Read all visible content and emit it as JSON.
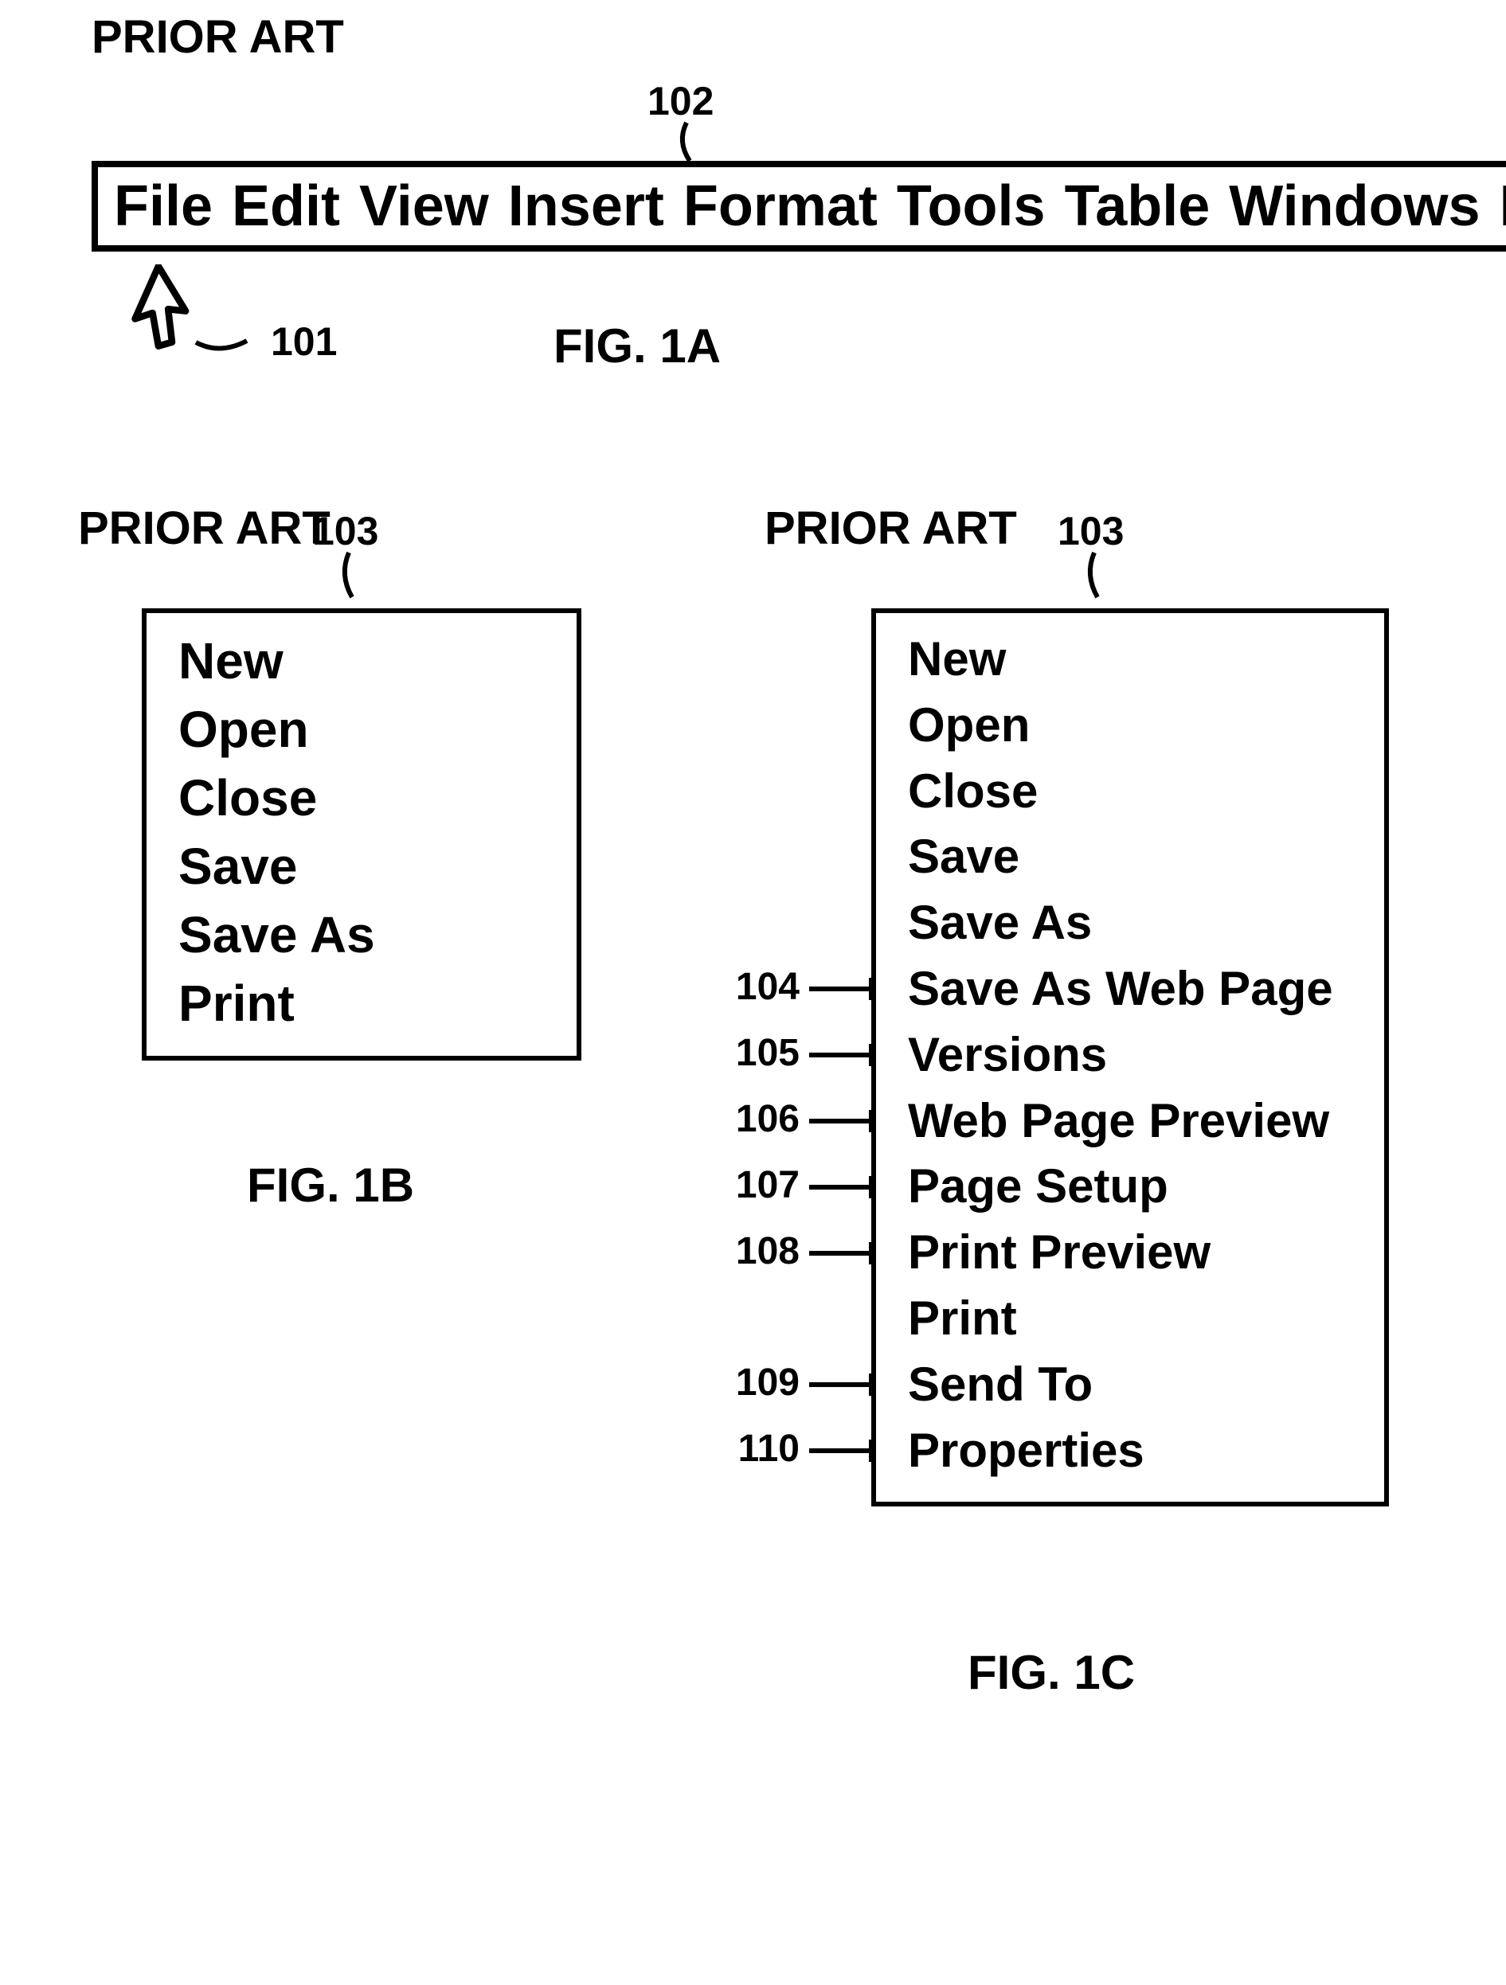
{
  "figA": {
    "prior_art": "PRIOR ART",
    "ref_102": "102",
    "ref_101": "101",
    "caption": "FIG. 1A"
  },
  "menubar": {
    "items": [
      "File",
      "Edit",
      "View",
      "Insert",
      "Format",
      "Tools",
      "Table",
      "Windows",
      "Help"
    ]
  },
  "figB": {
    "prior_art": "PRIOR ART",
    "ref_103": "103",
    "caption": "FIG. 1B"
  },
  "dropdownB": {
    "items": [
      "New",
      "Open",
      "Close",
      "Save",
      "Save As",
      "Print"
    ]
  },
  "figC": {
    "prior_art": "PRIOR ART",
    "ref_103": "103",
    "caption": "FIG. 1C"
  },
  "dropdownC": {
    "items": [
      "New",
      "Open",
      "Close",
      "Save",
      "Save As",
      "Save As Web Page",
      "Versions",
      "Web Page Preview",
      "Page Setup",
      "Print Preview",
      "Print",
      "Send To",
      "Properties"
    ],
    "side_refs": [
      {
        "label": "104",
        "index": 5
      },
      {
        "label": "105",
        "index": 6
      },
      {
        "label": "106",
        "index": 7
      },
      {
        "label": "107",
        "index": 8
      },
      {
        "label": "108",
        "index": 9
      },
      {
        "label": "109",
        "index": 11
      },
      {
        "label": "110",
        "index": 12
      }
    ]
  }
}
